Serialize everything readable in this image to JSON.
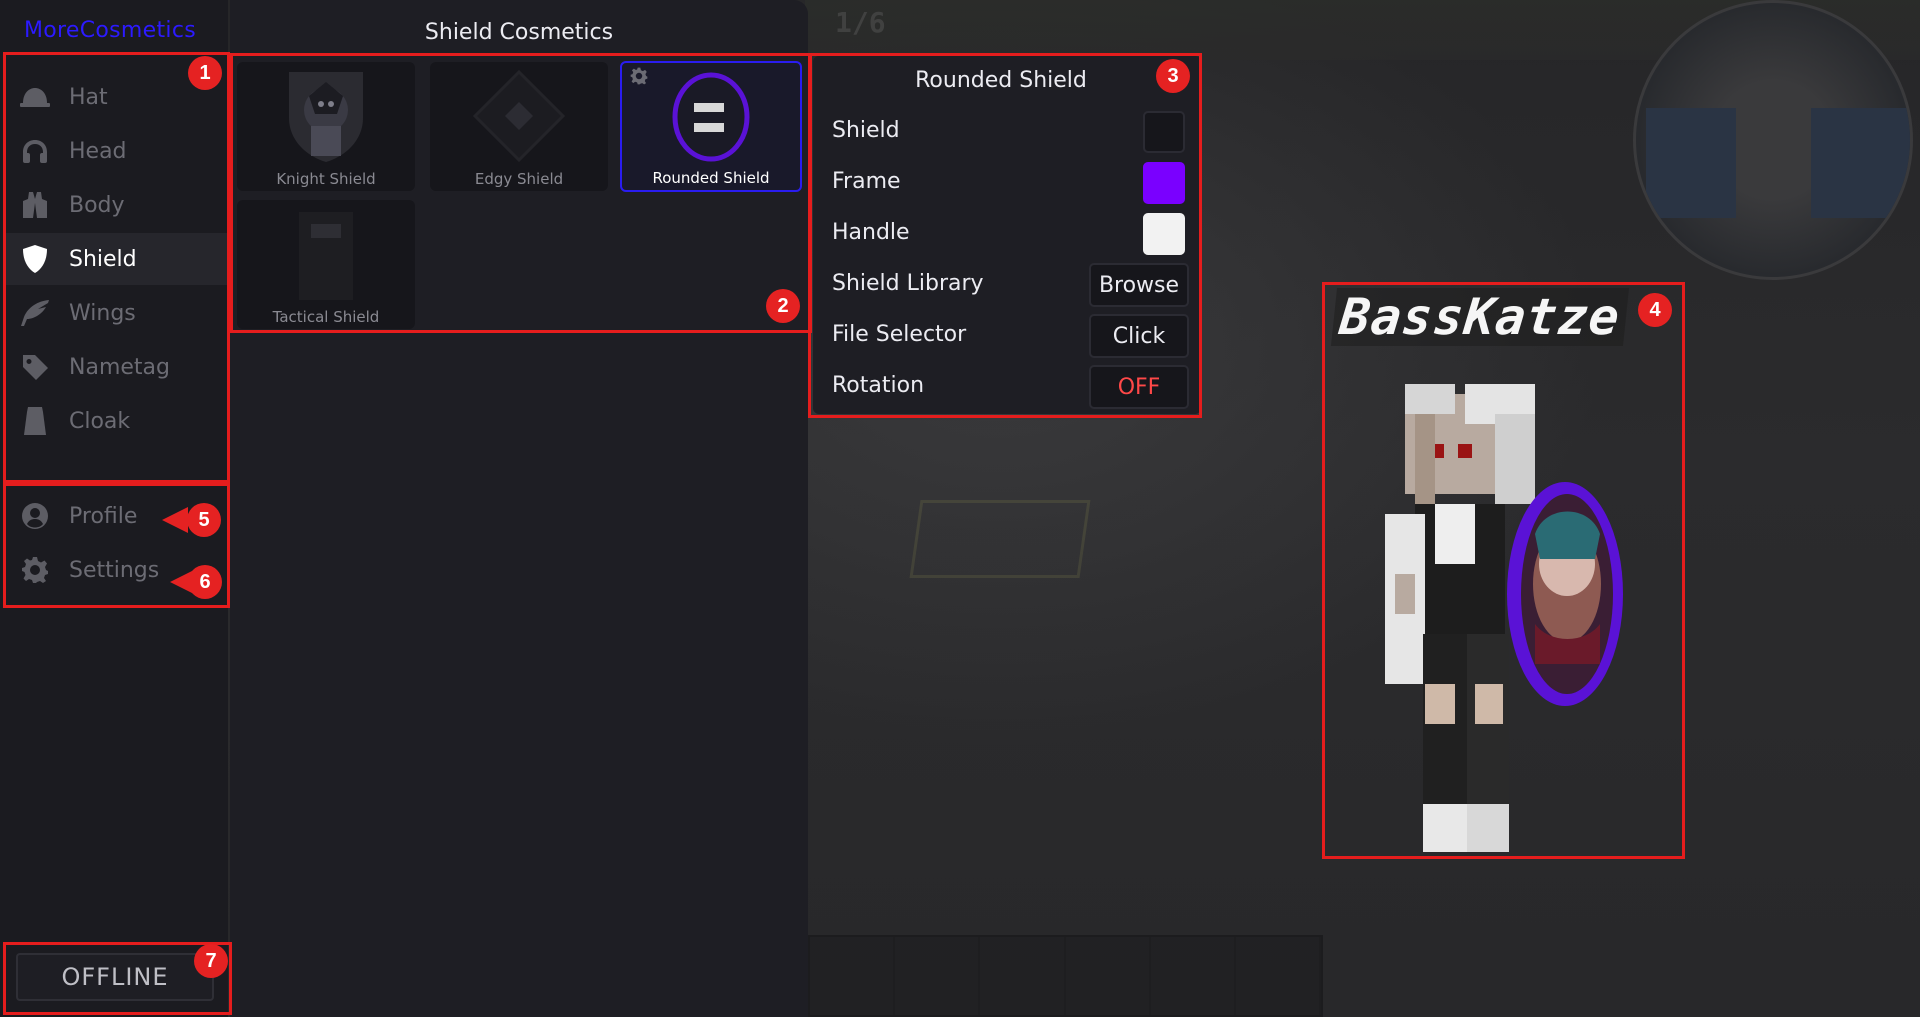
{
  "app": {
    "brand": "MoreCosmetics"
  },
  "sidebar": {
    "items": [
      {
        "label": "Hat",
        "icon": "hardhat-icon"
      },
      {
        "label": "Head",
        "icon": "headphones-icon"
      },
      {
        "label": "Body",
        "icon": "vest-icon"
      },
      {
        "label": "Shield",
        "icon": "shield-icon"
      },
      {
        "label": "Wings",
        "icon": "feather-icon"
      },
      {
        "label": "Nametag",
        "icon": "tag-icon"
      },
      {
        "label": "Cloak",
        "icon": "cloak-icon"
      }
    ],
    "active": "Shield",
    "secondary": [
      {
        "label": "Profile",
        "icon": "user-circle-icon"
      },
      {
        "label": "Settings",
        "icon": "gear-icon"
      }
    ],
    "status_button": "OFFLINE"
  },
  "grid": {
    "title": "Shield Cosmetics",
    "tiles": [
      {
        "label": "Knight Shield"
      },
      {
        "label": "Edgy Shield"
      },
      {
        "label": "Rounded Shield",
        "selected": true
      },
      {
        "label": "Tactical Shield"
      }
    ]
  },
  "options": {
    "title": "Rounded Shield",
    "rows": [
      {
        "label": "Shield",
        "type": "color",
        "color": "#16161b"
      },
      {
        "label": "Frame",
        "type": "color",
        "color": "#7a00ff"
      },
      {
        "label": "Handle",
        "type": "color",
        "color": "#f2f2f2"
      },
      {
        "label": "Shield Library",
        "type": "button",
        "value": "Browse"
      },
      {
        "label": "File Selector",
        "type": "button",
        "value": "Click"
      },
      {
        "label": "Rotation",
        "type": "button",
        "value": "OFF"
      }
    ]
  },
  "preview": {
    "player_name": "BassKatze"
  },
  "hud": {
    "counter": "1/6"
  },
  "annotations": [
    "1",
    "2",
    "3",
    "4",
    "5",
    "6",
    "7"
  ],
  "colors": {
    "accent": "#2c1aff",
    "annotation": "#e52222",
    "off": "#ff4848"
  }
}
